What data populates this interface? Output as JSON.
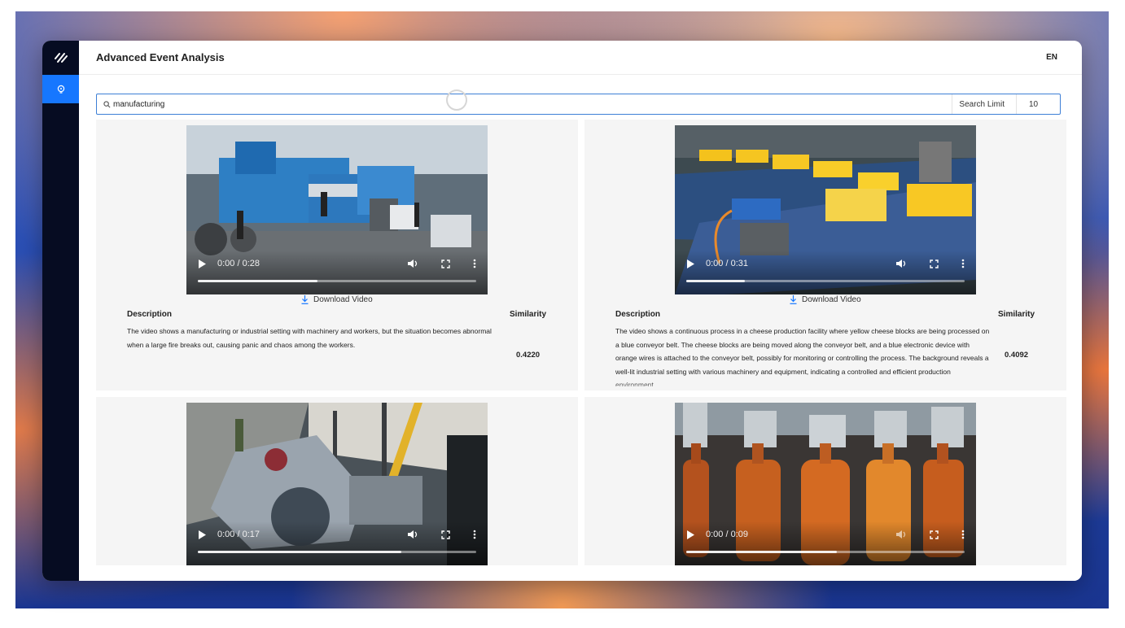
{
  "app": {
    "title": "Advanced Event Analysis",
    "language": "EN"
  },
  "search": {
    "query": "manufacturing",
    "limit_label": "Search Limit",
    "limit_value": "10"
  },
  "results": [
    {
      "time": "0:00 / 0:28",
      "progress": 0.43,
      "download_label": "Download Video",
      "description_label": "Description",
      "similarity_label": "Similarity",
      "description": "The video shows a manufacturing or industrial setting with machinery and workers, but the situation becomes abnormal when a large fire breaks out, causing panic and chaos among the workers.",
      "similarity": "0.4220"
    },
    {
      "time": "0:00 / 0:31",
      "progress": 0.21,
      "download_label": "Download Video",
      "description_label": "Description",
      "similarity_label": "Similarity",
      "description": "The video shows a continuous process in a cheese production facility where yellow cheese blocks are being processed on a blue conveyor belt. The cheese blocks are being moved along the conveyor belt, and a blue electronic device with orange wires is attached to the conveyor belt, possibly for monitoring or controlling the process. The background reveals a well-lit industrial setting with various machinery and equipment, indicating a controlled and efficient production environment.",
      "similarity": "0.4092"
    },
    {
      "time": "0:00 / 0:17",
      "progress": 0.73
    },
    {
      "time": "0:00 / 0:09",
      "progress": 0.54
    }
  ],
  "colors": {
    "accent": "#1677ff",
    "sidebar": "#060c22",
    "search_border": "#3d7fd6",
    "card_bg": "#f5f5f5"
  }
}
